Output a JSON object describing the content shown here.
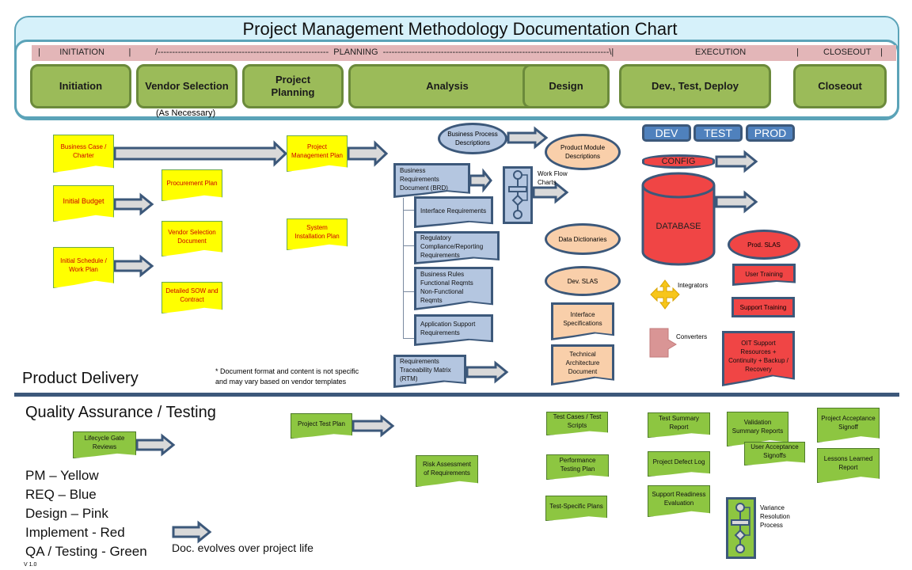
{
  "header": {
    "title": "Project Management Methodology Documentation Chart",
    "phases": [
      {
        "label": "|        INITIATION          |"
      },
      {
        "label": "/-----------------------------------------------------------  PLANNING  ------------------------------------------------------------------------------\\|"
      },
      {
        "label": "EXECUTION"
      },
      {
        "label": "|"
      },
      {
        "label": "CLOSEOUT"
      },
      {
        "label": "|"
      }
    ],
    "stages": [
      "Initiation",
      "Vendor Selection",
      "Project Planning",
      "Analysis",
      "Design",
      "Dev., Test, Deploy",
      "Closeout"
    ],
    "note": "(As Necessary)"
  },
  "environments": [
    "DEV",
    "TEST",
    "PROD"
  ],
  "pm_docs": {
    "business_case": "Business Case / Charter",
    "initial_budget": "Initial Budget",
    "initial_schedule": "Initial Schedule / Work Plan",
    "procurement_plan": "Procurement Plan",
    "vendor_selection_doc": "Vendor Selection Document",
    "detailed_sow": "Detailed SOW and Contract",
    "pm_plan": "Project Management Plan",
    "system_install_plan": "System Installation Plan"
  },
  "req_docs": {
    "business_process": "Business Process Descriptions",
    "brd": "Business Requirements Document (BRD)",
    "interface_req": "Interface Requirements",
    "regulatory": "Regulatory Compliance/Reporting Requirements",
    "business_rules": "Business Rules Functional Reqmts Non-Functional Reqmts",
    "app_support": "Application Support Requirements",
    "rtm": "Requirements Traceability Matrix (RTM)"
  },
  "design_docs": {
    "product_module": "Product Module Descriptions",
    "workflow": "Work Flow Charts",
    "data_dict": "Data Dictionaries",
    "dev_slas": "Dev. SLAS",
    "interface_spec": "Interface Specifications",
    "tech_arch": "Technical Architecture Document"
  },
  "impl_docs": {
    "config": "CONFIG",
    "database": "DATABASE",
    "prod_slas": "Prod. SLAS",
    "user_training": "User Training",
    "support_training": "Support Training",
    "integrators": "Integrators",
    "converters": "Converters",
    "oit_support": "OIT Support Resources + Continuity + Backup / Recovery"
  },
  "product_delivery": {
    "title": "Product Delivery",
    "footnote_1": "* Document format and content is not specific",
    "footnote_2": "and may vary based on vendor templates"
  },
  "qa": {
    "title": "Quality Assurance / Testing",
    "lifecycle": "Lifecycle Gate Reviews",
    "test_plan": "Project Test Plan",
    "risk": "Risk Assessment of Requirements",
    "test_cases": "Test Cases / Test Scripts",
    "perf": "Performance Testing Plan",
    "test_specific": "Test-Specific Plans",
    "test_summary": "Test Summary Report",
    "defect_log": "Project Defect Log",
    "support_ready": "Support Readiness Evaluation",
    "validation": "Validation Summary Reports",
    "uat": "User Acceptance Signoffs",
    "variance": "Variance Resolution Process",
    "acceptance": "Project Acceptance Signoff",
    "lessons": "Lessons Learned Report"
  },
  "legend": {
    "items": [
      "PM – Yellow",
      "REQ – Blue",
      "Design – Pink",
      "Implement - Red",
      "QA / Testing - Green"
    ],
    "arrow_label": "Doc. evolves over project life",
    "version": "V 1.0"
  },
  "colors": {
    "pm": "#ffff00",
    "req": "#b4c6e0",
    "design": "#f9cfaa",
    "implement": "#f04545",
    "qa": "#8dc641",
    "stage": "#9bbb59",
    "phase_bar": "#e3b6b8",
    "arrow_stroke": "#3c587a",
    "arrow_fill": "#d9d9d9"
  }
}
